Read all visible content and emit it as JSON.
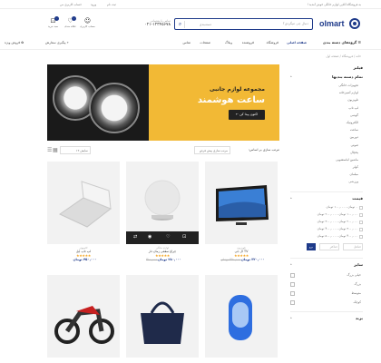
{
  "topbar": {
    "left": [
      "ثبت نام",
      "ورود",
      "حساب کاربری من"
    ],
    "right": "به فروشگاه آنلاین لوازم خانگی خوش آمدید !"
  },
  "header": {
    "logo_text": "olmart",
    "search_placeholder": "دنبال چی میگردی؟",
    "search_category": "دسته‌بندی",
    "phone_label": "تماس با پشتیبانی",
    "phone_number": "۰۲۱-۱۲۳۴۵۶۷۸",
    "icons": [
      {
        "name": "user-icon",
        "label": "حساب کاربری"
      },
      {
        "name": "heart-icon",
        "label": "علاقه مندی",
        "count": "۰"
      },
      {
        "name": "cart-icon",
        "label": "سبد خرید",
        "count": "۰"
      }
    ]
  },
  "nav": {
    "all_categories": "گروه‌های دسته بندی",
    "items": [
      "صفحه اصلی",
      "فروشگاه",
      "فروشنده",
      "وبلاگ",
      "صفحات",
      "تماس"
    ],
    "right_links": [
      "پیگیری سفارش",
      "فروش ویژه"
    ]
  },
  "breadcrumb": "خانه / فروشگاه / صفحه اول",
  "sidebar": {
    "filter_title": "فیلتر",
    "categories_title": "تمام دسته بندیها",
    "categories": [
      "تجهیزات خانگی",
      "لوازم آشپزخانه",
      "تلویزیون",
      "لپ تاپ",
      "گوشی",
      "الکترونیک",
      "ساعت",
      "دوربین",
      "صوتی",
      "یخچال",
      "ماشین لباسشویی",
      "کولر",
      "مبلمان",
      "ورزشی"
    ],
    "price_title": "قیمت",
    "price_rows": [
      "۰ تومان - ۱۰۰,۰۰۰ تومان",
      "۱۰۰,۰۰۰ تومان - ۲۰۰,۰۰۰ تومان",
      "۲۰۰,۰۰۰ تومان - ۳۰۰,۰۰۰ تومان",
      "۳۰۰,۰۰۰ تومان - ۴۰۰,۰۰۰ تومان",
      "۴۰۰,۰۰۰ تومان - ۵۰۰,۰۰۰ تومان"
    ],
    "price_min": "حداقل",
    "price_max": "حداکثر",
    "price_go": "برو",
    "size_title": "سایز",
    "sizes": [
      "خیلی بزرگ",
      "بزرگ",
      "متوسط",
      "کوچک"
    ],
    "brand_title": "برند"
  },
  "banner": {
    "line1": "مجموعه لوازم جانبی",
    "line2": "ساعت هوشمند",
    "button": "اکنون پیدا کن"
  },
  "toolbar": {
    "sort_label": "مرتب سازی بر اساس:",
    "sort_value": "مرتب سازی پیش فرض",
    "show_value": "نمایش ۱۲"
  },
  "products": [
    {
      "cat": "تلویزیون",
      "name": "TV ال جی",
      "price": "۳۲۰,۰۰۰ تومان",
      "old": "۳۹۰,۰۰۰ تومان"
    },
    {
      "cat": "لوازم خانگی",
      "name": "چراغ سقفی زمان دار",
      "price": "۲۸۰,۰۰۰ تومان",
      "old": "۳۱۰,۰۰۰"
    },
    {
      "cat": "کامپیوتر",
      "name": "لپ تاپ اپل",
      "price": "۴۵۰,۰۰۰ تومان",
      "old": ""
    }
  ],
  "colors": {
    "brand": "#1e3a8a",
    "banner": "#f2b935",
    "star": "#f5a623"
  }
}
